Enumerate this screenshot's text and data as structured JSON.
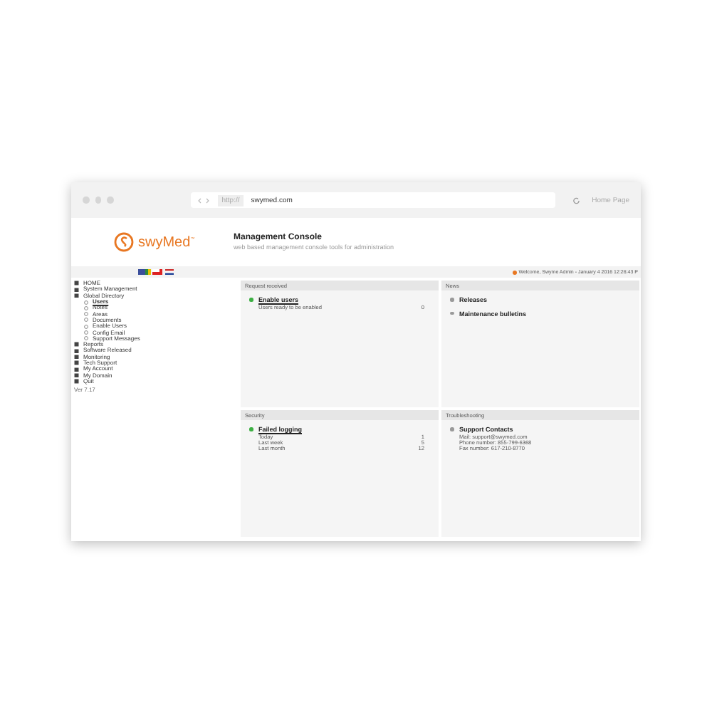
{
  "browser": {
    "scheme": "http://",
    "url": "swymed.com",
    "home": "Home Page"
  },
  "header": {
    "logo": "swyMed",
    "logo_mark": "™",
    "title": "Management Console",
    "subtitle": "web based management console tools for administration"
  },
  "status_bar": {
    "welcome": "Welcome, Swyme Admin - January 4 2016 12:26:43 P"
  },
  "sidebar": {
    "items": [
      {
        "label": "HOME",
        "selected": false
      },
      {
        "label": "System Management",
        "selected": false
      },
      {
        "label": "Global Directory",
        "selected": false,
        "children": [
          {
            "label": "Users",
            "selected": true
          },
          {
            "label": "Notes",
            "selected": false
          },
          {
            "label": "Areas",
            "selected": false
          },
          {
            "label": "Documents",
            "selected": false
          },
          {
            "label": "Enable Users",
            "selected": false
          },
          {
            "label": "Config Email",
            "selected": false
          },
          {
            "label": "Support Messages",
            "selected": false
          }
        ]
      },
      {
        "label": "Reports",
        "selected": false
      },
      {
        "label": "Software Released",
        "selected": false
      },
      {
        "label": "Monitoring",
        "selected": false
      },
      {
        "label": "Tech Support",
        "selected": false
      },
      {
        "label": "My Account",
        "selected": false
      },
      {
        "label": "My Domain",
        "selected": false
      },
      {
        "label": "Quit",
        "selected": false
      }
    ],
    "version": "Ver 7.17"
  },
  "panels": [
    {
      "title": "Request received",
      "entries": [
        {
          "title": "Enable users",
          "color": "#3cb043",
          "underlined": true,
          "lines": [
            {
              "label": "Users ready to be enabled",
              "value": "0"
            }
          ]
        }
      ]
    },
    {
      "title": "News",
      "entries": [
        {
          "title": "Releases",
          "color": "#9a9a9a",
          "underlined": false
        },
        {
          "title": "Maintenance bulletins",
          "color": "#9a9a9a",
          "underlined": false
        }
      ]
    },
    {
      "title": "Security",
      "entries": [
        {
          "title": "Failed logging",
          "color": "#3cb043",
          "underlined": true,
          "lines": [
            {
              "label": "Today",
              "value": "1"
            },
            {
              "label": "Last week",
              "value": "5"
            },
            {
              "label": "Last month",
              "value": "12"
            }
          ]
        }
      ]
    },
    {
      "title": "Troubleshooting",
      "entries": [
        {
          "title": "Support Contacts",
          "color": "#9a9a9a",
          "underlined": false,
          "lines": [
            {
              "label": "Mail: support@swymed.com"
            },
            {
              "label": "Phone number: 855-799-6368"
            },
            {
              "label": "Fax number: 617-210-8770"
            }
          ]
        }
      ]
    }
  ]
}
